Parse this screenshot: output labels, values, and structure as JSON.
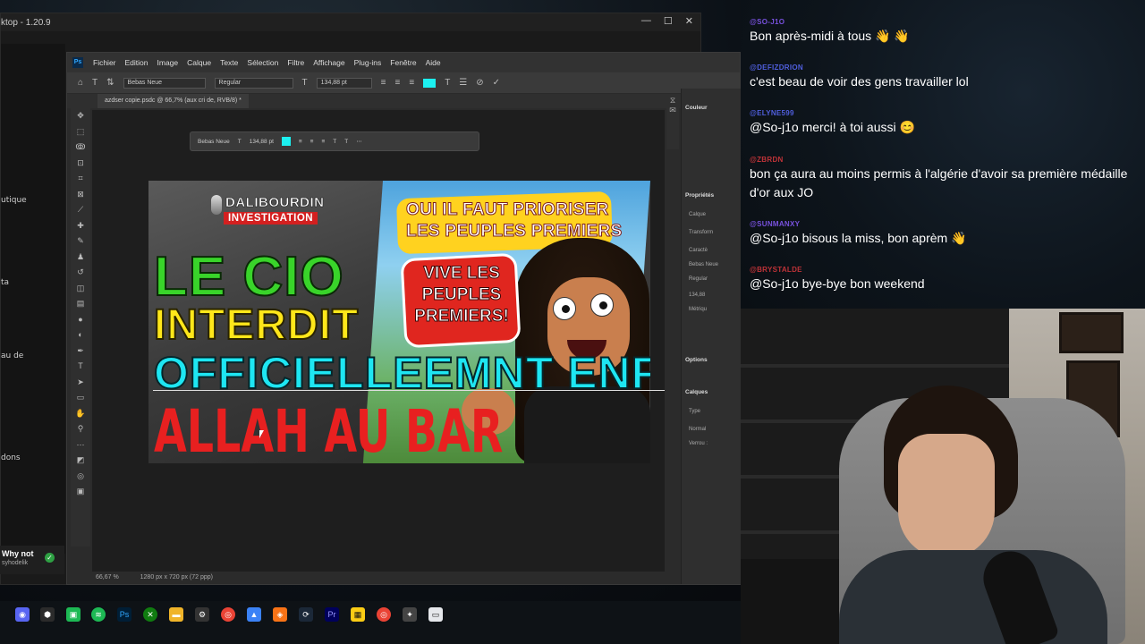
{
  "back_app": {
    "title": "ktop - 1.20.9",
    "sidebar_labels": [
      "utique",
      "ta",
      "au de",
      "dons"
    ],
    "notification": {
      "title": "Why not",
      "subtitle": "syhodelik"
    }
  },
  "photoshop": {
    "menu": [
      "Fichier",
      "Edition",
      "Image",
      "Calque",
      "Texte",
      "Sélection",
      "Filtre",
      "Affichage",
      "Plug-ins",
      "Fenêtre",
      "Aide"
    ],
    "options": {
      "font_family": "Bebas Neue",
      "font_style": "Regular",
      "font_size": "134,88 pt",
      "text_color": "#1cf0f0"
    },
    "doc_tab": "azdser copie.psdc @ 66,7% (aux cri de, RVB/8) *",
    "status": {
      "zoom": "66,67 %",
      "doc_info": "1280 px x 720 px (72 ppp)"
    },
    "floatbar": {
      "font_family": "Bebas Neue",
      "font_size": "134,88 pt"
    },
    "right_panel": {
      "couleur": "Couleur",
      "proprietes": "Propriétés",
      "calque": "Calque",
      "transform": "Transform",
      "caractere": "Caractè",
      "font_family": "Bebas Neue",
      "font_style": "Regular",
      "size": "134,88",
      "metrics": "Métriqu",
      "options": "Options",
      "calques": "Calques",
      "type_filter": "Type",
      "blend_mode": "Normal",
      "lock": "Verrou :"
    }
  },
  "thumbnail": {
    "brand_top": "DALIBOURDIN",
    "brand_bottom": "INVESTIGATION",
    "bubble_top_1": "OUI IL FAUT PRIORISER",
    "bubble_top_2": "LES PEUPLES PREMIERS",
    "bubble_red_1": "VIVE LES",
    "bubble_red_2": "PEUPLES",
    "bubble_red_3": "PREMIERS!",
    "headline_1": "LE CIO",
    "headline_2": "INTERDIT",
    "headline_3": "OFFICIELLEEMNT ENFII",
    "headline_4": "ALLAH AU BAR"
  },
  "chat": {
    "messages": [
      {
        "user": "@SO-J1O",
        "user_color": "#8a5cff",
        "text": "Bon après-midi à tous  👋 👋"
      },
      {
        "user": "@DEFIZDRION",
        "user_color": "#5b6cff",
        "text": "c'est beau de voir des gens travailler lol"
      },
      {
        "user": "@ELYNE599",
        "user_color": "#5b6cff",
        "text": "@So-j1o merci! à toi aussi 😊"
      },
      {
        "user": "@ZBRDN",
        "user_color": "#e0393e",
        "text": "bon ça aura au moins permis à l'algérie d'avoir sa première médaille d'or aux JO"
      },
      {
        "user": "@SUNMANXY",
        "user_color": "#8a5cff",
        "text": "@So-j1o bisous la miss, bon aprèm  👋"
      },
      {
        "user": "@BRYSTALDE",
        "user_color": "#e0393e",
        "text": "@So-j1o bye-bye bon weekend"
      }
    ]
  },
  "taskbar": {
    "icons": [
      "discord-icon",
      "privacy-icon",
      "app-icon",
      "spotify-icon",
      "photoshop-icon",
      "xbox-icon",
      "folder-icon",
      "settings-icon",
      "chrome-icon",
      "photos-icon",
      "obs-icon",
      "steam-icon",
      "premiere-icon",
      "notes-icon",
      "chrome-alt-icon",
      "game-icon",
      "box-icon"
    ]
  }
}
